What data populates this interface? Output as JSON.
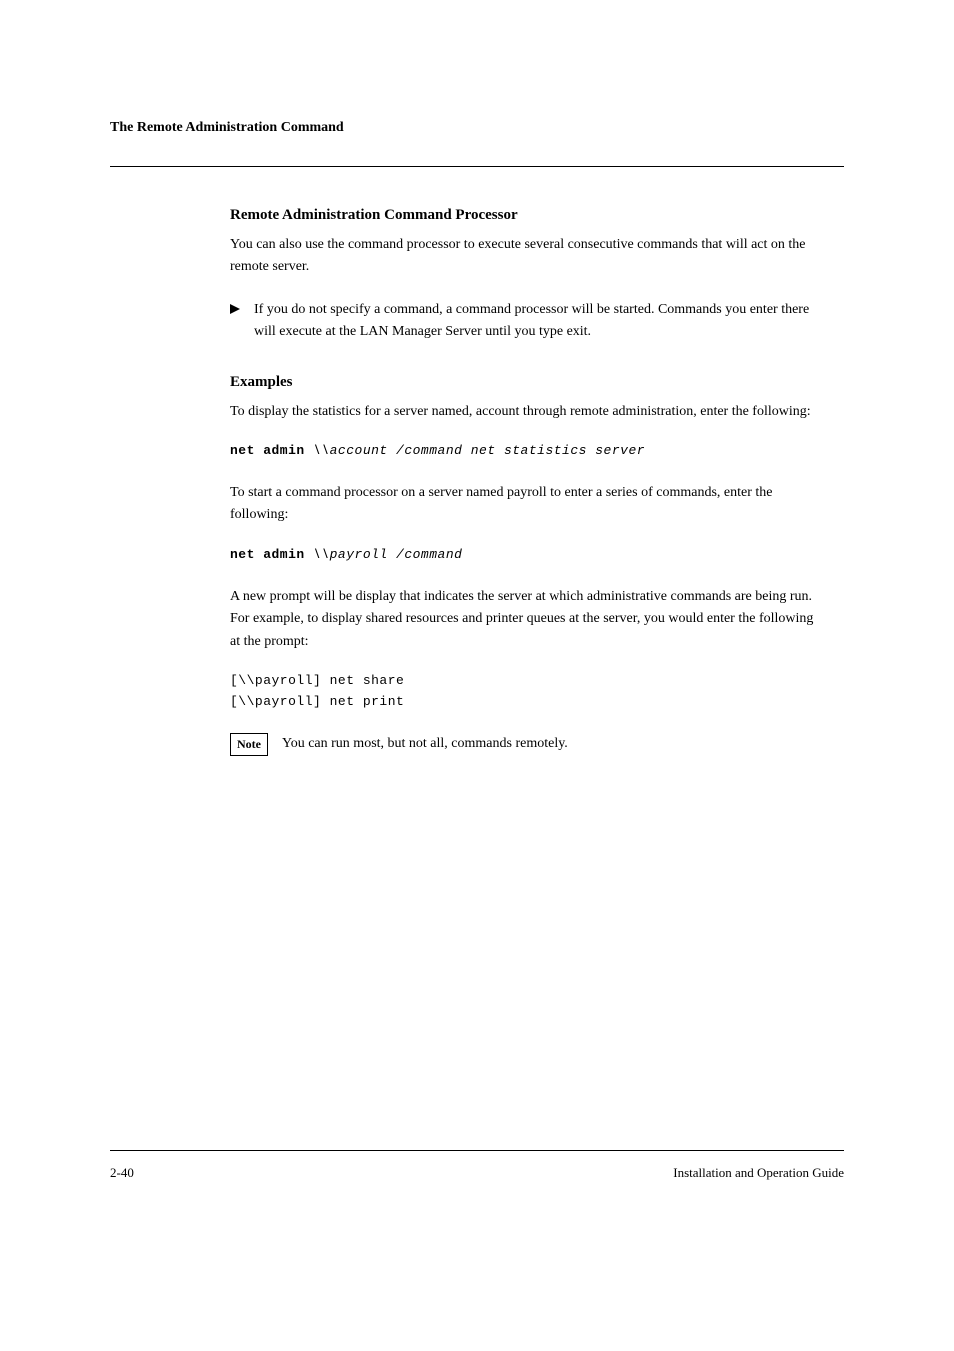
{
  "header": "The Remote Administration Command",
  "section": {
    "title": "Remote Administration Command Processor",
    "intro": "You can also use the command processor to execute several consecutive commands that will act on the remote server.",
    "bullet": "If you do not specify a command, a command processor will be started. Commands you enter there will execute at the LAN Manager Server until you type exit."
  },
  "examples": {
    "title": "Examples",
    "ex1": {
      "text": "To display the statistics for a server named, account through remote administration, enter the following:",
      "code_prefix": "net admin ",
      "code_args": "\\\\account /command net statistics server"
    },
    "ex2": {
      "text": "To start a command processor on a server named payroll to enter a series of commands, enter the following:",
      "code_prefix": "net admin ",
      "code_args": "\\\\payroll /command"
    },
    "ex3": {
      "text": "A new prompt will be display that indicates the server at which administrative commands are being run. For example, to display shared resources and printer queues at the server, you would enter the following at the prompt:",
      "code_line1": "[\\\\payroll] net share",
      "code_line2": "[\\\\payroll] net print"
    },
    "note_box": "Note",
    "note_text": "You can run most, but not all, commands remotely."
  },
  "footer": {
    "page": "2-40",
    "text": "Installation and Operation Guide"
  }
}
